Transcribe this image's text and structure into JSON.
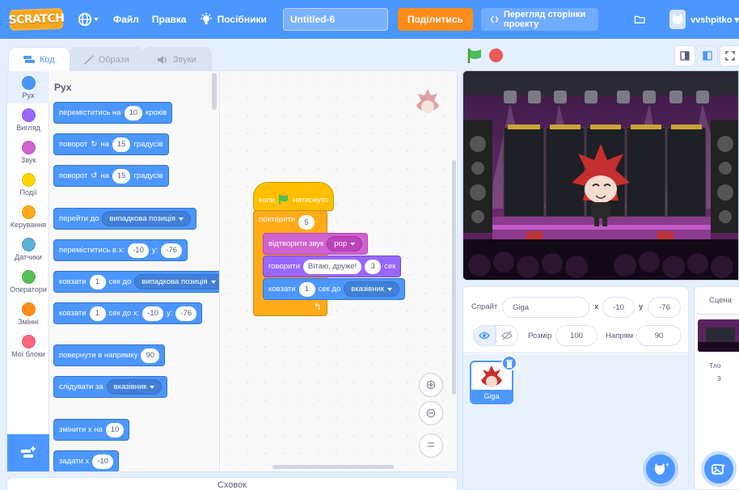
{
  "menubar": {
    "logo": "SCRATCH",
    "file": "Файл",
    "edit": "Правка",
    "tutorials": "Посібники",
    "project_title": "Untitled-6",
    "share": "Поділитись",
    "see_project_page": "Перегляд сторінки проекту",
    "username": "vvshpitko"
  },
  "tabs": {
    "code": "Код",
    "costumes": "Образи",
    "sounds": "Звуки"
  },
  "categories": [
    {
      "label": "Рух",
      "color": "#4c97ff"
    },
    {
      "label": "Вигляд",
      "color": "#9966ff"
    },
    {
      "label": "Звук",
      "color": "#cf63cf"
    },
    {
      "label": "Події",
      "color": "#ffd500"
    },
    {
      "label": "Керування",
      "color": "#ffab19"
    },
    {
      "label": "Датчики",
      "color": "#5cb1d6"
    },
    {
      "label": "Оператори",
      "color": "#59c059"
    },
    {
      "label": "Змінні",
      "color": "#ff8c1a"
    },
    {
      "label": "Мої блоки",
      "color": "#ff6680"
    }
  ],
  "flyout": {
    "title": "Рух",
    "move": {
      "pre": "переміститись на",
      "val": "10",
      "post": "кроків"
    },
    "turn_right": {
      "pre": "поворот",
      "mid": "на",
      "val": "15",
      "post": "градусів"
    },
    "turn_left": {
      "pre": "поворот",
      "mid": "на",
      "val": "15",
      "post": "градусів"
    },
    "goto": {
      "pre": "перейти до",
      "drop": "випадкова позиція"
    },
    "goto_xy": {
      "pre": "переміститись в x:",
      "x": "-10",
      "ylab": "y:",
      "y": "-76"
    },
    "glide_to": {
      "pre": "ковзати",
      "val": "1",
      "mid": "сек до",
      "drop": "випадкова позиція"
    },
    "glide_xy": {
      "pre": "ковзати",
      "val": "1",
      "mid": "сек до x:",
      "x": "-10",
      "ylab": "y:",
      "y": "-76"
    },
    "point_dir": {
      "pre": "повернути в напрямку",
      "val": "90"
    },
    "point_towards": {
      "pre": "слідувати за",
      "drop": "вказівник"
    },
    "change_x": {
      "pre": "змінити x на",
      "val": "10"
    },
    "set_x": {
      "pre": "задати x",
      "val": "-10"
    }
  },
  "script": {
    "when_flag": {
      "pre": "коли",
      "post": "натиснуто"
    },
    "repeat": {
      "pre": "повторити",
      "val": "5"
    },
    "play_sound": {
      "pre": "відтворити звук",
      "drop": "pop"
    },
    "say": {
      "pre": "говорити",
      "text": "Вітаю, друже!",
      "secs": "3",
      "post": "сек"
    },
    "glide": {
      "pre": "ковзати",
      "val": "1",
      "mid": "сек до",
      "drop": "вказівник"
    }
  },
  "backpack": "Сховок",
  "sprite_info": {
    "sprite_label": "Спрайт",
    "sprite_name": "Giga",
    "x_label": "x",
    "x": "-10",
    "y_label": "y",
    "y": "-76",
    "show_label": "Показати",
    "size_label": "Розмір",
    "size": "100",
    "direction_label": "Напрям",
    "direction": "90"
  },
  "sprites": [
    {
      "name": "Giga"
    }
  ],
  "stage_pane": {
    "title": "Сцена",
    "backdrops_label": "Тло",
    "backdrops_count": "3"
  },
  "colors": {
    "primary": "#4c97ff",
    "share": "#ff8c1a",
    "stop": "#ec5959",
    "flag": "#4cbf56"
  }
}
